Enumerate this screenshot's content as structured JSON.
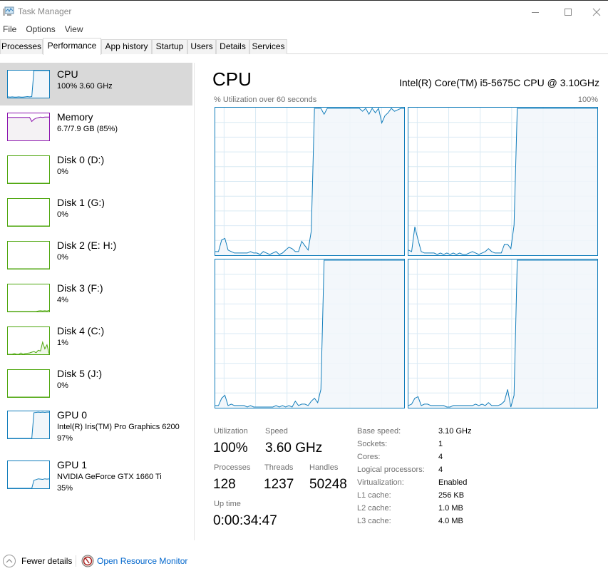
{
  "window": {
    "title": "Task Manager",
    "icon": "task-manager-icon",
    "controls": [
      "minimize",
      "maximize",
      "close"
    ]
  },
  "menu": [
    "File",
    "Options",
    "View"
  ],
  "tabs": [
    {
      "label": "Processes",
      "active": false
    },
    {
      "label": "Performance",
      "active": true
    },
    {
      "label": "App history",
      "active": false
    },
    {
      "label": "Startup",
      "active": false
    },
    {
      "label": "Users",
      "active": false
    },
    {
      "label": "Details",
      "active": false
    },
    {
      "label": "Services",
      "active": false
    }
  ],
  "colors": {
    "cpu": "#117dbb",
    "cpu_fill": "#f1f6fa",
    "memory": "#8b12ae",
    "memory_fill": "#f4f2f4",
    "disk": "#4da60c",
    "disk_fill": "#eff7e9",
    "gpu": "#117dbb",
    "grid": "#d9eaf4",
    "selected_bg": "#d9d9d9",
    "link": "#0066cc"
  },
  "sidebar": {
    "items": [
      {
        "name": "CPU",
        "sub": "100% 3.60 GHz",
        "sub2": "",
        "kind": "cpu",
        "selected": true,
        "series": [
          3,
          2,
          3,
          2,
          2,
          3,
          2,
          2,
          3,
          4,
          3,
          4,
          100,
          100,
          100,
          100,
          100,
          100,
          100,
          100
        ]
      },
      {
        "name": "Memory",
        "sub": "6.7/7.9 GB (85%)",
        "sub2": "",
        "kind": "memory",
        "selected": false,
        "series": [
          85,
          85,
          85,
          85,
          85,
          85,
          85,
          85,
          85,
          85,
          85,
          70,
          78,
          82,
          84,
          86,
          85,
          86,
          86,
          86
        ]
      },
      {
        "name": "Disk 0 (D:)",
        "sub": "0%",
        "sub2": "",
        "kind": "disk",
        "selected": false,
        "series": [
          0,
          0,
          0,
          0,
          0,
          0,
          0,
          0,
          0,
          0,
          0,
          0,
          0,
          0,
          0,
          0,
          0,
          0,
          0,
          0
        ]
      },
      {
        "name": "Disk 1 (G:)",
        "sub": "0%",
        "sub2": "",
        "kind": "disk",
        "selected": false,
        "series": [
          0,
          0,
          0,
          0,
          0,
          0,
          0,
          0,
          0,
          0,
          0,
          0,
          0,
          0,
          0,
          0,
          0,
          0,
          0,
          0
        ]
      },
      {
        "name": "Disk 2 (E: H:)",
        "sub": "0%",
        "sub2": "",
        "kind": "disk",
        "selected": false,
        "series": [
          0,
          0,
          0,
          0,
          0,
          0,
          0,
          0,
          0,
          0,
          0,
          0,
          0,
          0,
          0,
          0,
          0,
          0,
          0,
          0
        ]
      },
      {
        "name": "Disk 3 (F:)",
        "sub": "4%",
        "sub2": "",
        "kind": "disk",
        "selected": false,
        "series": [
          0,
          0,
          0,
          0,
          0,
          0,
          0,
          0,
          0,
          0,
          0,
          0,
          0,
          0,
          2,
          3,
          2,
          3,
          2,
          4
        ]
      },
      {
        "name": "Disk 4 (C:)",
        "sub": "1%",
        "sub2": "",
        "kind": "disk",
        "selected": false,
        "series": [
          0,
          0,
          0,
          3,
          0,
          0,
          5,
          0,
          3,
          4,
          5,
          8,
          10,
          6,
          15,
          12,
          45,
          20,
          35,
          1
        ]
      },
      {
        "name": "Disk 5 (J:)",
        "sub": "0%",
        "sub2": "",
        "kind": "disk",
        "selected": false,
        "series": [
          0,
          0,
          0,
          0,
          0,
          0,
          0,
          0,
          0,
          0,
          0,
          0,
          0,
          0,
          0,
          0,
          0,
          0,
          0,
          0
        ]
      },
      {
        "name": "GPU 0",
        "sub": "Intel(R) Iris(TM) Pro Graphics 6200",
        "sub2": "97%",
        "kind": "gpu",
        "selected": false,
        "series": [
          0,
          0,
          0,
          0,
          0,
          0,
          0,
          0,
          0,
          0,
          0,
          0,
          95,
          96,
          97,
          96,
          97,
          96,
          97,
          97
        ]
      },
      {
        "name": "GPU 1",
        "sub": "NVIDIA GeForce GTX 1660 Ti",
        "sub2": "35%",
        "kind": "gpu",
        "selected": false,
        "series": [
          0,
          0,
          0,
          0,
          0,
          0,
          0,
          0,
          0,
          0,
          0,
          0,
          30,
          32,
          35,
          34,
          33,
          35,
          34,
          35
        ]
      }
    ]
  },
  "main": {
    "title": "CPU",
    "model": "Intel(R) Core(TM) i5-5675C CPU @ 3.10GHz",
    "graph_caption": "% Utilization over 60 seconds",
    "graph_max": "100%",
    "stats": {
      "utilization_label": "Utilization",
      "utilization": "100%",
      "speed_label": "Speed",
      "speed": "3.60 GHz",
      "processes_label": "Processes",
      "processes": "128",
      "threads_label": "Threads",
      "threads": "1237",
      "handles_label": "Handles",
      "handles": "50248",
      "uptime_label": "Up time",
      "uptime": "0:00:34:47"
    },
    "specs": [
      {
        "label": "Base speed:",
        "value": "3.10 GHz"
      },
      {
        "label": "Sockets:",
        "value": "1"
      },
      {
        "label": "Cores:",
        "value": "4"
      },
      {
        "label": "Logical processors:",
        "value": "4"
      },
      {
        "label": "Virtualization:",
        "value": "Enabled"
      },
      {
        "label": "L1 cache:",
        "value": "256 KB"
      },
      {
        "label": "L2 cache:",
        "value": "1.0 MB"
      },
      {
        "label": "L3 cache:",
        "value": "4.0 MB"
      }
    ]
  },
  "chart_data": {
    "type": "line",
    "title": "% Utilization over 60 seconds",
    "xlabel": "",
    "ylabel": "% Utilization",
    "ylim": [
      0,
      100
    ],
    "xlim": [
      0,
      60
    ],
    "grid": true,
    "series": [
      {
        "name": "Core 0",
        "values": [
          2,
          2,
          10,
          11,
          3,
          2,
          1,
          1,
          1,
          1,
          1,
          2,
          1,
          1,
          0,
          2,
          1,
          0,
          1,
          2,
          0,
          1,
          3,
          5,
          4,
          2,
          2,
          9,
          6,
          3,
          16,
          100,
          100,
          100,
          96,
          100,
          100,
          100,
          100,
          100,
          100,
          100,
          100,
          100,
          100,
          100,
          98,
          100,
          96,
          100,
          97,
          100,
          90,
          95,
          97,
          100,
          98,
          99,
          100,
          100
        ]
      },
      {
        "name": "Core 1",
        "values": [
          3,
          2,
          19,
          10,
          2,
          1,
          1,
          1,
          1,
          0,
          1,
          0,
          1,
          0,
          1,
          0,
          1,
          0,
          0,
          1,
          2,
          1,
          0,
          1,
          2,
          4,
          2,
          1,
          1,
          1,
          7,
          7,
          4,
          20,
          100,
          100,
          100,
          100,
          100,
          100,
          100,
          100,
          100,
          100,
          100,
          100,
          100,
          100,
          100,
          100,
          100,
          100,
          100,
          100,
          100,
          100,
          100,
          100,
          100,
          100
        ]
      },
      {
        "name": "Core 2",
        "values": [
          1,
          1,
          6,
          8,
          1,
          2,
          1,
          1,
          1,
          1,
          0,
          1,
          0,
          0,
          0,
          0,
          0,
          0,
          0,
          1,
          0,
          1,
          0,
          1,
          0,
          4,
          1,
          2,
          2,
          1,
          4,
          6,
          3,
          12,
          100,
          100,
          100,
          100,
          100,
          100,
          100,
          100,
          100,
          100,
          100,
          100,
          100,
          100,
          100,
          100,
          100,
          100,
          100,
          100,
          100,
          100,
          100,
          100,
          100,
          100
        ]
      },
      {
        "name": "Core 3",
        "values": [
          1,
          2,
          6,
          7,
          1,
          2,
          2,
          1,
          1,
          1,
          1,
          1,
          0,
          0,
          1,
          1,
          1,
          1,
          1,
          1,
          1,
          2,
          1,
          2,
          1,
          3,
          1,
          1,
          1,
          2,
          4,
          12,
          0,
          8,
          100,
          100,
          100,
          100,
          100,
          100,
          100,
          100,
          100,
          100,
          100,
          100,
          100,
          100,
          100,
          100,
          100,
          100,
          100,
          100,
          100,
          100,
          100,
          100,
          100,
          100
        ]
      }
    ]
  },
  "footer": {
    "fewer_details": "Fewer details",
    "open_resource_monitor": "Open Resource Monitor"
  }
}
